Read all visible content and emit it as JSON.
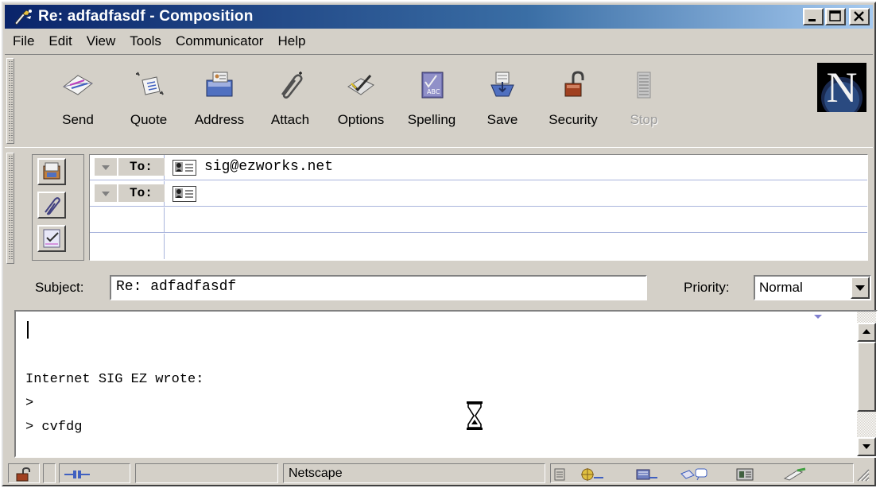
{
  "window": {
    "title": "Re: adfadfasdf - Composition",
    "controls": [
      "minimize",
      "maximize",
      "close"
    ]
  },
  "menu": [
    "File",
    "Edit",
    "View",
    "Tools",
    "Communicator",
    "Help"
  ],
  "toolbar": {
    "buttons": [
      {
        "label": "Send",
        "icon": "send-icon"
      },
      {
        "label": "Quote",
        "icon": "quote-icon"
      },
      {
        "label": "Address",
        "icon": "address-book-icon"
      },
      {
        "label": "Attach",
        "icon": "paperclip-icon"
      },
      {
        "label": "Options",
        "icon": "options-checkmark-icon"
      },
      {
        "label": "Spelling",
        "icon": "spellcheck-icon"
      },
      {
        "label": "Save",
        "icon": "save-icon"
      },
      {
        "label": "Security",
        "icon": "padlock-icon"
      },
      {
        "label": "Stop",
        "icon": "stop-icon",
        "disabled": true
      }
    ],
    "logo_letter": "N"
  },
  "addressing": {
    "rows": [
      {
        "type": "To:",
        "value": "sig@ezworks.net"
      },
      {
        "type": "To:",
        "value": ""
      },
      {
        "type": "",
        "value": ""
      },
      {
        "type": "",
        "value": ""
      }
    ]
  },
  "subject": {
    "label": "Subject:",
    "value": "Re: adfadfasdf"
  },
  "priority": {
    "label": "Priority:",
    "value": "Normal"
  },
  "body": {
    "lines": [
      "Internet SIG EZ wrote:",
      ">",
      "> cvfdg"
    ]
  },
  "status": {
    "text": "Netscape"
  },
  "colors": {
    "title_start": "#0a246a",
    "title_end": "#a6caf0",
    "chrome": "#d4d0c8"
  }
}
